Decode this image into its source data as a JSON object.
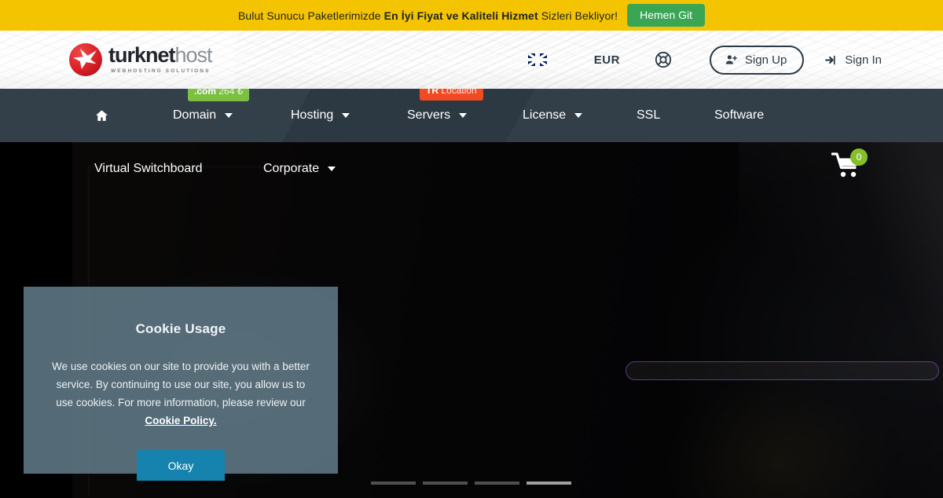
{
  "promo": {
    "text_before": "Bulut Sunucu Paketlerimizde ",
    "text_bold": "En İyi Fiyat ve Kaliteli Hizmet",
    "text_after": " Sizleri Bekliyor!",
    "button_label": "Hemen Git",
    "bg_color": "#f5c400",
    "button_color": "#3aa655"
  },
  "header": {
    "logo": {
      "word_primary": "turknet",
      "word_secondary": "host",
      "tagline": "WEBHOSTING SOLUTIONS"
    },
    "language_icon": "uk-flag-icon",
    "currency": "EUR",
    "support_icon": "lifebuoy-icon",
    "signup_label": "Sign Up",
    "signup_icon": "user-plus-icon",
    "signin_label": "Sign In",
    "signin_icon": "sign-in-arrow-icon"
  },
  "navbar": {
    "bg_color": "#2e3b45",
    "home_icon": "home-icon",
    "items": [
      {
        "label": "Domain",
        "has_caret": true
      },
      {
        "label": "Hosting",
        "has_caret": true
      },
      {
        "label": "Servers",
        "has_caret": true
      },
      {
        "label": "License",
        "has_caret": true
      },
      {
        "label": "SSL",
        "has_caret": false
      },
      {
        "label": "Software",
        "has_caret": false
      }
    ],
    "badges": [
      {
        "name": "domain-price-badge",
        "strong": ".com",
        "light": "264 ₺",
        "color": "#7bc043"
      },
      {
        "name": "tr-location-badge",
        "strong": "TR",
        "light": "Location",
        "color": "#f04b23"
      }
    ]
  },
  "subnav": {
    "items": [
      {
        "label": "Virtual Switchboard",
        "has_caret": false
      },
      {
        "label": "Corporate",
        "has_caret": true
      }
    ]
  },
  "cart": {
    "icon": "shopping-cart-icon",
    "count": "0",
    "badge_color": "#86bf2a"
  },
  "hero": {
    "slider_dots": 4,
    "active_dot_index": 3
  },
  "cookie": {
    "title": "Cookie Usage",
    "body_part1": "We use cookies on our site to provide you with a better service. By continuing to use our site, you allow us to use cookies. For more information, please review our ",
    "link_label": "Cookie Policy.",
    "okay_label": "Okay",
    "button_color": "#1583ad"
  }
}
